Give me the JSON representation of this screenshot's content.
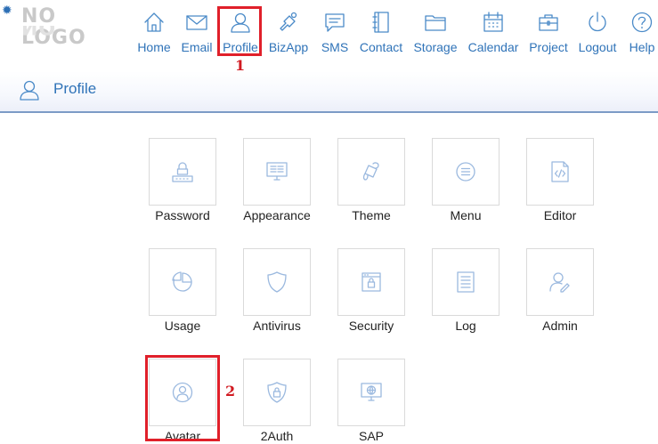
{
  "logo": {
    "text": "NO LOGO"
  },
  "nav": {
    "items": [
      {
        "label": "Home",
        "icon": "home-icon"
      },
      {
        "label": "Email",
        "icon": "email-icon"
      },
      {
        "label": "Profile",
        "icon": "profile-icon"
      },
      {
        "label": "BizApp",
        "icon": "bizapp-icon"
      },
      {
        "label": "SMS",
        "icon": "sms-icon"
      },
      {
        "label": "Contact",
        "icon": "contact-icon"
      },
      {
        "label": "Storage",
        "icon": "storage-icon"
      },
      {
        "label": "Calendar",
        "icon": "calendar-icon"
      },
      {
        "label": "Project",
        "icon": "project-icon"
      },
      {
        "label": "Logout",
        "icon": "logout-icon"
      },
      {
        "label": "Help",
        "icon": "help-icon"
      }
    ]
  },
  "header": {
    "title": "Profile"
  },
  "tiles": [
    {
      "label": "Password",
      "icon": "password-icon"
    },
    {
      "label": "Appearance",
      "icon": "appearance-icon"
    },
    {
      "label": "Theme",
      "icon": "theme-icon"
    },
    {
      "label": "Menu",
      "icon": "menu-icon"
    },
    {
      "label": "Editor",
      "icon": "editor-icon"
    },
    {
      "label": "Usage",
      "icon": "usage-icon"
    },
    {
      "label": "Antivirus",
      "icon": "antivirus-icon"
    },
    {
      "label": "Security",
      "icon": "security-icon"
    },
    {
      "label": "Log",
      "icon": "log-icon"
    },
    {
      "label": "Admin",
      "icon": "admin-icon"
    },
    {
      "label": "Avatar",
      "icon": "avatar-icon"
    },
    {
      "label": "2Auth",
      "icon": "2auth-icon"
    },
    {
      "label": "SAP",
      "icon": "sap-icon"
    }
  ],
  "annotations": {
    "step1": "1",
    "step2": "2"
  },
  "colors": {
    "accent": "#2f73b8",
    "highlight": "#e0202a",
    "icon": "#9bb9df"
  }
}
